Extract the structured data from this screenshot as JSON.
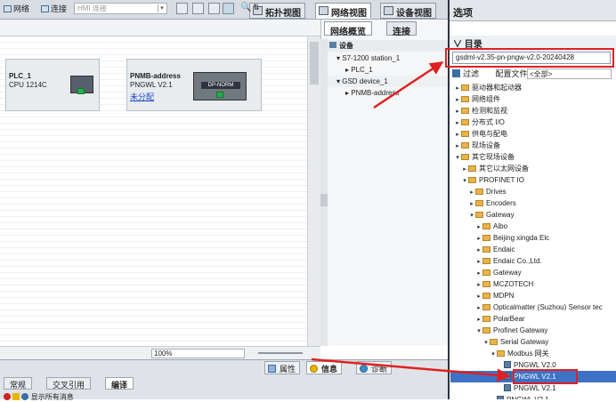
{
  "view_tabs": {
    "topology": "拓扑视图",
    "network": "网络视图",
    "device": "设备视图"
  },
  "toolbar": {
    "network": "网络",
    "connect": "连接",
    "hmi_placeholder": "HMI 连接"
  },
  "devices": [
    {
      "name": "PLC_1",
      "type": "CPU 1214C"
    },
    {
      "name": "PNMB-address",
      "type": "PNGWL V2.1",
      "link": "未分配",
      "module_label": "DP-NORM"
    }
  ],
  "zoom": "100%",
  "overview": {
    "tab_overview": "网络概览",
    "tab_connect": "连接",
    "header": "设备",
    "rows": [
      "S7-1200 station_1",
      "PLC_1",
      "GSD device_1",
      "PNMB-address"
    ]
  },
  "bottom_tabs": {
    "properties": "属性",
    "info": "信息",
    "diagnostics": "诊断",
    "general": "常规",
    "cross_ref": "交叉引用",
    "compile": "编译",
    "status_text": "显示所有消息"
  },
  "options": {
    "title": "选项",
    "catalog_title": "目录",
    "search_value": "gsdml-v2.35-pn-pngw-v2.0-20240428",
    "filter_label": "过滤",
    "profile_label": "配置文件",
    "profile_value": "<全部>",
    "tree": [
      {
        "label": "驱动器和起动器",
        "depth": 0,
        "kind": "folder",
        "expanded": false
      },
      {
        "label": "网络组件",
        "depth": 0,
        "kind": "folder",
        "expanded": false
      },
      {
        "label": "检测和监视",
        "depth": 0,
        "kind": "folder",
        "expanded": false
      },
      {
        "label": "分布式 I/O",
        "depth": 0,
        "kind": "folder",
        "expanded": false
      },
      {
        "label": "供电与配电",
        "depth": 0,
        "kind": "folder",
        "expanded": false
      },
      {
        "label": "现场设备",
        "depth": 0,
        "kind": "folder",
        "expanded": false
      },
      {
        "label": "其它现场设备",
        "depth": 0,
        "kind": "folder",
        "expanded": true
      },
      {
        "label": "其它以太网设备",
        "depth": 1,
        "kind": "folder",
        "expanded": false
      },
      {
        "label": "PROFINET IO",
        "depth": 1,
        "kind": "folder",
        "expanded": true
      },
      {
        "label": "Drives",
        "depth": 2,
        "kind": "folder",
        "expanded": false
      },
      {
        "label": "Encoders",
        "depth": 2,
        "kind": "folder",
        "expanded": false
      },
      {
        "label": "Gateway",
        "depth": 2,
        "kind": "folder",
        "expanded": true
      },
      {
        "label": "Aibo",
        "depth": 3,
        "kind": "folder",
        "expanded": false
      },
      {
        "label": "Beijing xingda Elc",
        "depth": 3,
        "kind": "folder",
        "expanded": false
      },
      {
        "label": "Endaic",
        "depth": 3,
        "kind": "folder",
        "expanded": false
      },
      {
        "label": "Endaic Co.,Ltd.",
        "depth": 3,
        "kind": "folder",
        "expanded": false
      },
      {
        "label": "Gateway",
        "depth": 3,
        "kind": "folder",
        "expanded": false
      },
      {
        "label": "MCZOTECH",
        "depth": 3,
        "kind": "folder",
        "expanded": false
      },
      {
        "label": "MDPN",
        "depth": 3,
        "kind": "folder",
        "expanded": false
      },
      {
        "label": "Opticalmatter (Suzhou) Sensor tec",
        "depth": 3,
        "kind": "folder",
        "expanded": false
      },
      {
        "label": "PolarBear",
        "depth": 3,
        "kind": "folder",
        "expanded": false
      },
      {
        "label": "Profinet Gateway",
        "depth": 3,
        "kind": "folder",
        "expanded": true
      },
      {
        "label": "Serial Gateway",
        "depth": 4,
        "kind": "folder",
        "expanded": true
      },
      {
        "label": "Modbus 网关",
        "depth": 5,
        "kind": "folder",
        "expanded": true
      },
      {
        "label": "PNGWL V2.0",
        "depth": 6,
        "kind": "module",
        "expanded": false
      },
      {
        "label": "PNGWL V2.1",
        "depth": 6,
        "kind": "module",
        "expanded": false,
        "selected": true
      },
      {
        "label": "PNGWL V2.1",
        "depth": 6,
        "kind": "module",
        "expanded": false
      },
      {
        "label": "PNGWL V2.1",
        "depth": 5,
        "kind": "module",
        "expanded": false
      }
    ]
  },
  "colors": {
    "accent_red": "#e02020",
    "selection": "#3d72c6",
    "folder": "#e8b34a"
  }
}
